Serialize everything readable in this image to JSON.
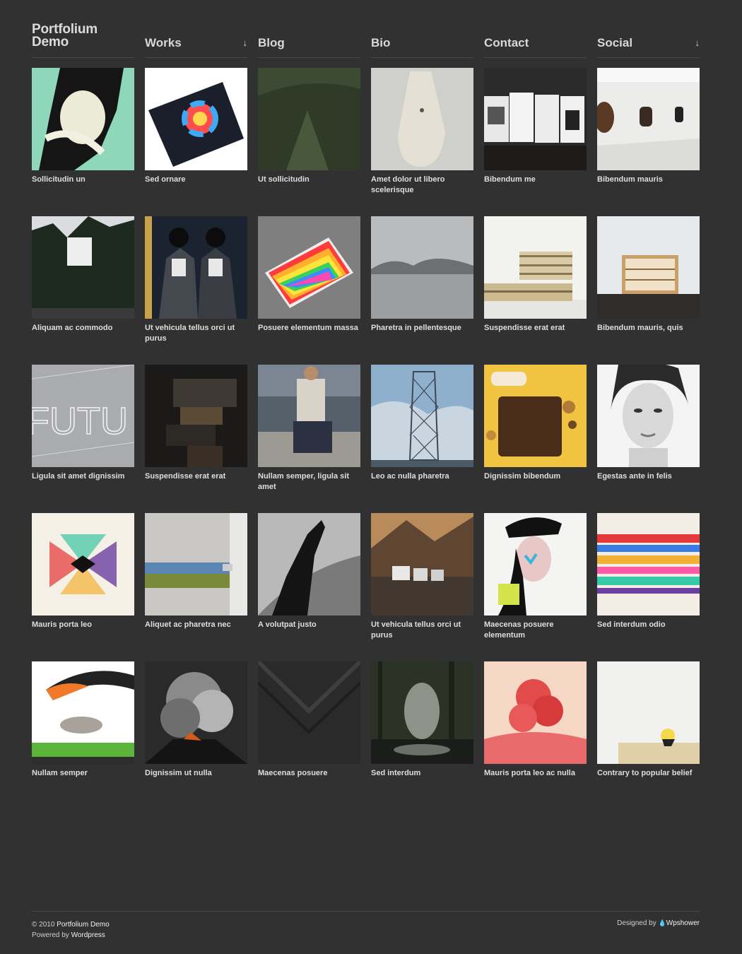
{
  "site": {
    "logo_line1": "Portfolium",
    "logo_line2": "Demo"
  },
  "nav": [
    {
      "label": "Works",
      "has_dropdown": true
    },
    {
      "label": "Blog",
      "has_dropdown": false
    },
    {
      "label": "Bio",
      "has_dropdown": false
    },
    {
      "label": "Contact",
      "has_dropdown": false
    },
    {
      "label": "Social",
      "has_dropdown": true
    }
  ],
  "dropdown_icon": "↓",
  "portfolio": [
    {
      "caption": "Sollicitudin un",
      "image": "portrait-paint"
    },
    {
      "caption": "Sed ornare",
      "image": "color-wheel-book"
    },
    {
      "caption": "Ut sollicitudin",
      "image": "forest-hill"
    },
    {
      "caption": "Amet dolor ut libero scelerisque",
      "image": "canvas-bag"
    },
    {
      "caption": "Bibendum me",
      "image": "book-covers"
    },
    {
      "caption": "Bibendum mauris",
      "image": "gallery-room"
    },
    {
      "caption": "Aliquam ac commodo",
      "image": "forest-house"
    },
    {
      "caption": "Ut vehicula tellus orci ut purus",
      "image": "mirror-men"
    },
    {
      "caption": "Posuere elementum massa",
      "image": "rainbow-book"
    },
    {
      "caption": "Pharetra in pellentesque",
      "image": "foggy-sea"
    },
    {
      "caption": "Suspendisse erat erat",
      "image": "pallet-shelf"
    },
    {
      "caption": "Bibendum mauris, quis",
      "image": "bookshelf-room"
    },
    {
      "caption": "Ligula sit amet dignissim",
      "image": "futu-type"
    },
    {
      "caption": "Suspendisse erat erat",
      "image": "dark-stairs"
    },
    {
      "caption": "Nullam semper, ligula sit amet",
      "image": "sitting-man"
    },
    {
      "caption": "Leo ac nulla pharetra",
      "image": "lattice-tower"
    },
    {
      "caption": "Dignissim bibendum",
      "image": "chocolate"
    },
    {
      "caption": "Egestas ante in felis",
      "image": "woman-face"
    },
    {
      "caption": "Mauris porta leo",
      "image": "x-logo"
    },
    {
      "caption": "Aliquet ac pharetra nec",
      "image": "zipper"
    },
    {
      "caption": "A volutpat justo",
      "image": "shadow-hand"
    },
    {
      "caption": "Ut vehicula tellus orci ut purus",
      "image": "mountain-houses"
    },
    {
      "caption": "Maecenas posuere elementum",
      "image": "sailor-girl"
    },
    {
      "caption": "Sed interdum odio",
      "image": "abstract-color"
    },
    {
      "caption": "Nullam semper",
      "image": "deer-fire"
    },
    {
      "caption": "Dignissim ut nulla",
      "image": "volcano-smoke"
    },
    {
      "caption": "Maecenas posuere",
      "image": "dark-fabric"
    },
    {
      "caption": "Sed interdum",
      "image": "forest-stream"
    },
    {
      "caption": "Mauris porta leo ac nulla",
      "image": "red-ink"
    },
    {
      "caption": "Contrary to popular belief",
      "image": "small-figure"
    }
  ],
  "footer": {
    "copyright_prefix": "© 2010",
    "site_link": "Portfolium Demo",
    "powered_prefix": "Powered by",
    "powered_link": "Wordpress",
    "designed_prefix": "Designed by",
    "designer_link": "Wpshower"
  }
}
